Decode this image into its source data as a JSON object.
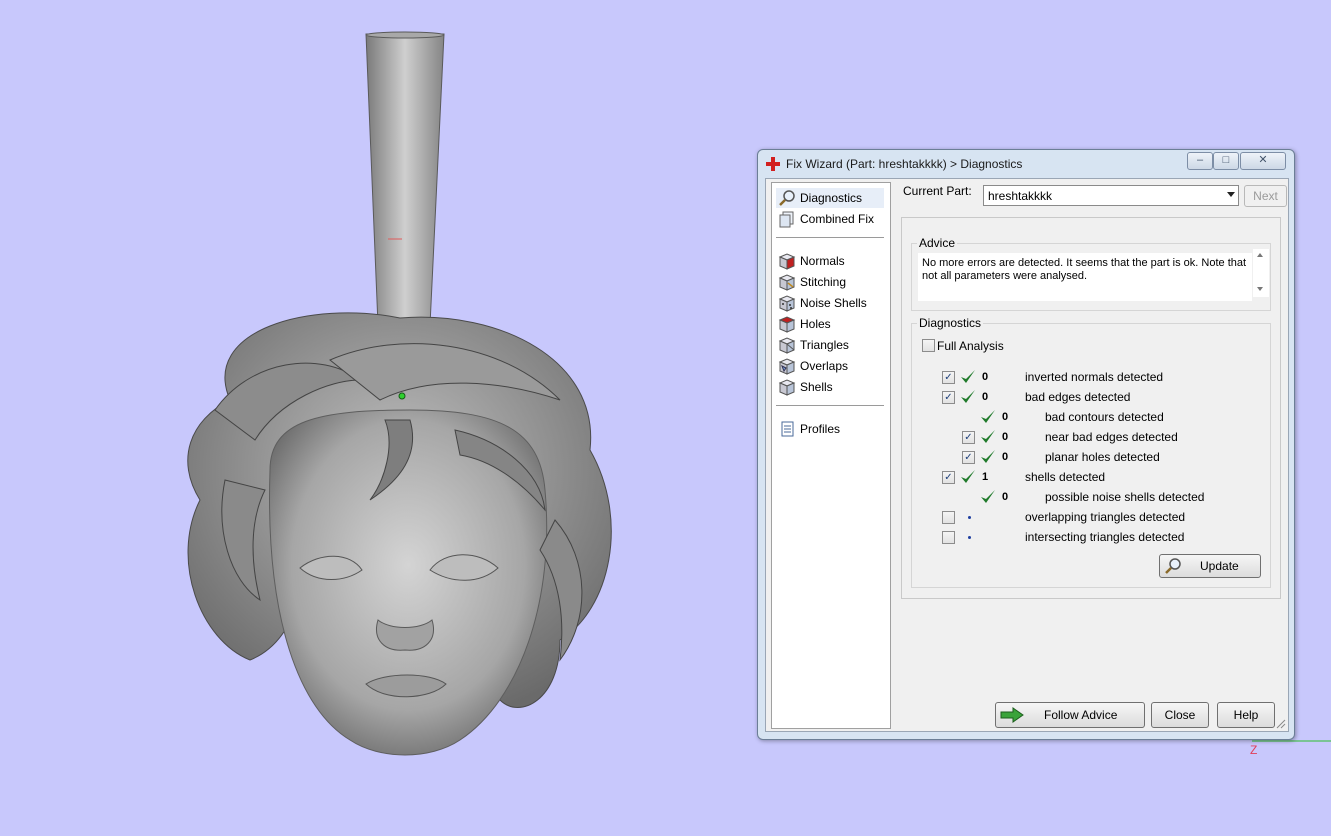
{
  "dialog": {
    "title": "Fix Wizard (Part: hreshtakkkk) > Diagnostics"
  },
  "nav": {
    "group1": [
      {
        "label": "Diagnostics",
        "icon": "magnifier-icon",
        "selected": true
      },
      {
        "label": "Combined Fix",
        "icon": "pages-icon",
        "selected": false
      }
    ],
    "group2": [
      {
        "label": "Normals",
        "icon": "normals-cube-icon"
      },
      {
        "label": "Stitching",
        "icon": "stitching-cube-icon"
      },
      {
        "label": "Noise Shells",
        "icon": "noise-shells-icon"
      },
      {
        "label": "Holes",
        "icon": "holes-cube-icon"
      },
      {
        "label": "Triangles",
        "icon": "triangles-cube-icon"
      },
      {
        "label": "Overlaps",
        "icon": "overlaps-cube-icon"
      },
      {
        "label": "Shells",
        "icon": "shells-cube-icon"
      }
    ],
    "group3": [
      {
        "label": "Profiles",
        "icon": "document-icon"
      }
    ]
  },
  "current_part": {
    "label": "Current Part:",
    "value": "hreshtakkkk"
  },
  "next_label": "Next",
  "advice": {
    "title": "Advice",
    "text": "No more errors are detected. It seems that the part is ok. Note that not all parameters were analysed."
  },
  "diagnostics": {
    "title": "Diagnostics",
    "full_analysis_label": "Full Analysis",
    "full_analysis_checked": false,
    "rows": [
      {
        "checkbox": true,
        "checked": true,
        "status": "ok",
        "count": "0",
        "label": "inverted normals detected",
        "indent": 0
      },
      {
        "checkbox": true,
        "checked": true,
        "status": "ok",
        "count": "0",
        "label": "bad edges detected",
        "indent": 0
      },
      {
        "checkbox": false,
        "checked": false,
        "status": "ok",
        "count": "0",
        "label": "bad contours detected",
        "indent": 1
      },
      {
        "checkbox": true,
        "checked": true,
        "status": "ok",
        "count": "0",
        "label": "near bad edges detected",
        "indent": 1
      },
      {
        "checkbox": true,
        "checked": true,
        "status": "ok",
        "count": "0",
        "label": "planar holes detected",
        "indent": 1
      },
      {
        "checkbox": true,
        "checked": true,
        "status": "ok",
        "count": "1",
        "label": "shells detected",
        "indent": 0
      },
      {
        "checkbox": false,
        "checked": false,
        "status": "ok",
        "count": "0",
        "label": "possible noise shells detected",
        "indent": 1
      },
      {
        "checkbox": true,
        "checked": false,
        "status": "dot",
        "count": "",
        "label": "overlapping triangles detected",
        "indent": 0
      },
      {
        "checkbox": true,
        "checked": false,
        "status": "dot",
        "count": "",
        "label": "intersecting triangles detected",
        "indent": 0
      }
    ],
    "update_label": "Update"
  },
  "footer": {
    "follow_advice_label": "Follow Advice",
    "close_label": "Close",
    "help_label": "Help"
  },
  "axis": {
    "z_label": "Z"
  },
  "colors": {
    "viewport_bg": "#c8c8fc",
    "check_green": "#1f7a2a",
    "model_gray": "#9a9a9a"
  }
}
